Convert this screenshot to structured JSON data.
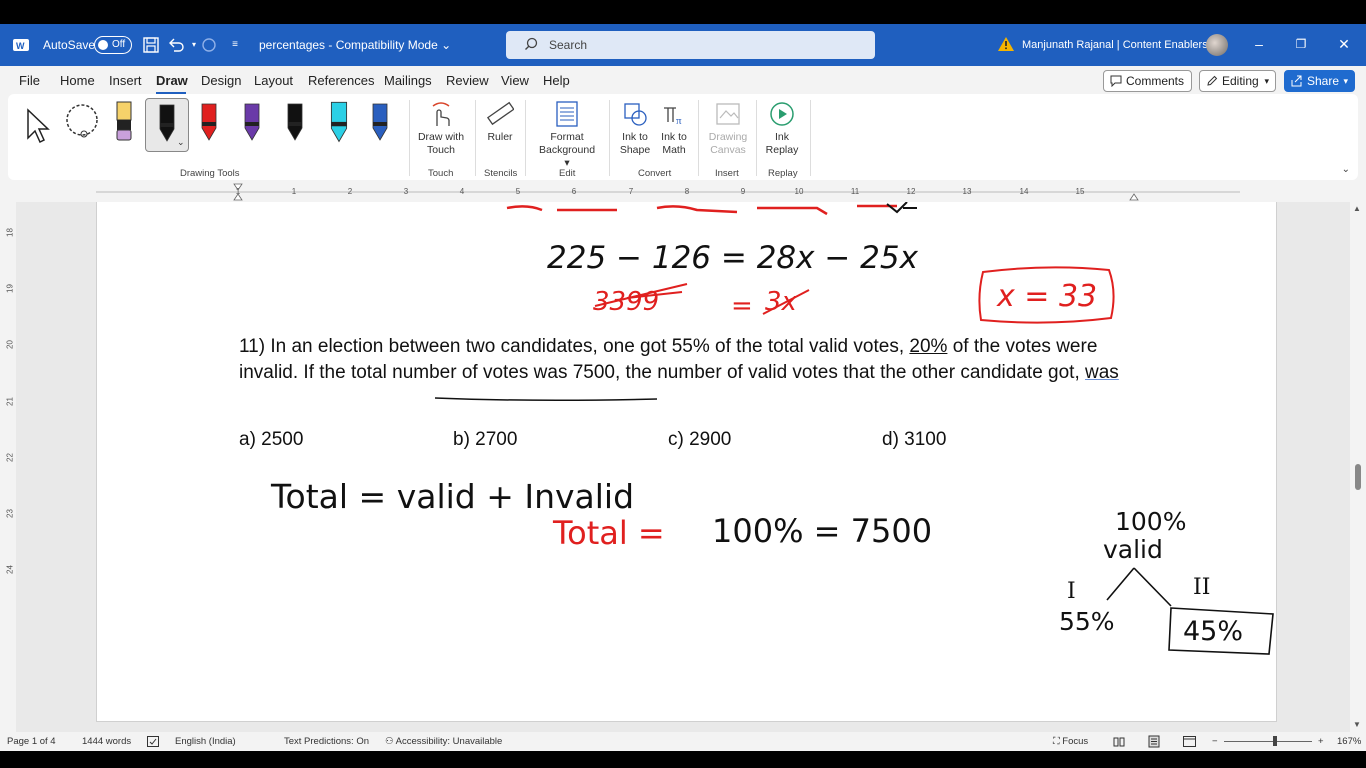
{
  "titlebar": {
    "autosave_label": "AutoSave",
    "autosave_state": "Off",
    "doc_title": "percentages  -  Compatibility Mode",
    "search_placeholder": "Search",
    "user": "Manjunath Rajanal | Content Enablers",
    "accent": "#1f5fbf"
  },
  "menu": {
    "items": [
      "File",
      "Home",
      "Insert",
      "Draw",
      "Design",
      "Layout",
      "References",
      "Mailings",
      "Review",
      "View",
      "Help"
    ],
    "active": "Draw",
    "comments": "Comments",
    "editing": "Editing",
    "share": "Share"
  },
  "ribbon": {
    "groups": {
      "drawing_tools": "Drawing Tools",
      "touch": "Touch",
      "stencils": "Stencils",
      "edit": "Edit",
      "convert": "Convert",
      "insert": "Insert",
      "replay": "Replay"
    },
    "buttons": {
      "draw_with_touch_1": "Draw with",
      "draw_with_touch_2": "Touch",
      "ruler": "Ruler",
      "format_bg_1": "Format",
      "format_bg_2": "Background",
      "ink_to_shape_1": "Ink to",
      "ink_to_shape_2": "Shape",
      "ink_to_math_1": "Ink to",
      "ink_to_math_2": "Math",
      "drawing_canvas_1": "Drawing",
      "drawing_canvas_2": "Canvas",
      "ink_replay_1": "Ink",
      "ink_replay_2": "Replay"
    },
    "pen_colors": [
      "#111111",
      "#e0201f",
      "#6a3aa8",
      "#111111",
      "#2bd0e6",
      "#2a5fbf"
    ]
  },
  "ruler": {
    "h": [
      "1",
      "1",
      "2",
      "3",
      "4",
      "5",
      "6",
      "7",
      "8",
      "9",
      "10",
      "11",
      "12",
      "13",
      "14",
      "15"
    ],
    "v": [
      "18",
      "19",
      "20",
      "21",
      "22",
      "23",
      "24"
    ]
  },
  "question": {
    "number": "11)",
    "part1": "In an election between two candidates, one got 55% of the total valid votes,",
    "pct": "20%",
    "part2": "of the votes were invalid. If the total number of votes was 7500, the number of valid votes that the other candidate got,",
    "was": "was"
  },
  "options": {
    "a": "a) 2500",
    "b": "b) 2700",
    "c": "c) 2900",
    "d": "d) 3100"
  },
  "handwriting": {
    "line1": "225 − 126  =  28x − 25x",
    "line2_struck_left": "3399",
    "line2_struck_right": "3x",
    "boxed": "x = 33",
    "total_eq": "Total  =  valid  +  Invalid",
    "total_red": "Total  =",
    "total_value": "100%  =  7500",
    "tree_top1": "100%",
    "tree_top2": "valid",
    "branch_1_label": "I",
    "branch_2_label": "II",
    "branch_1_value": "55%",
    "branch_2_value": "45%",
    "ink_red": "#e0201f",
    "ink_black": "#111111"
  },
  "status": {
    "page": "Page 1 of 4",
    "words": "1444 words",
    "language": "English (India)",
    "text_predictions": "Text Predictions: On",
    "accessibility": "Accessibility: Unavailable",
    "focus": "Focus",
    "zoom": "167%"
  }
}
